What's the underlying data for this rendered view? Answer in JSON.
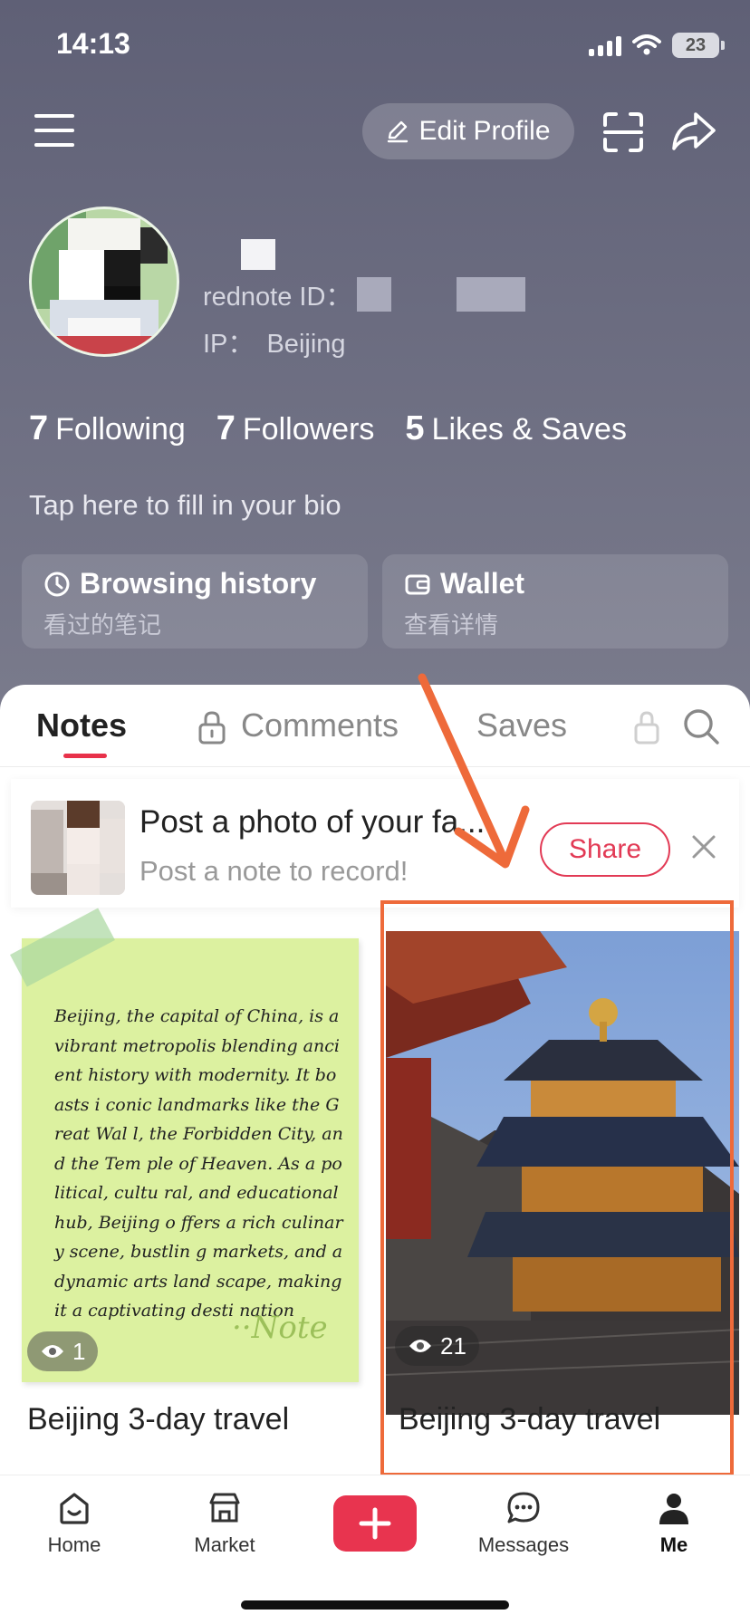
{
  "status_bar": {
    "time": "14:13",
    "battery": "23"
  },
  "header": {
    "edit_profile_label": "Edit Profile",
    "rednote_id_label": "rednote ID：",
    "ip_label": "IP：",
    "ip_value": "Beijing"
  },
  "stats": [
    {
      "count": "7",
      "label": "Following"
    },
    {
      "count": "7",
      "label": "Followers"
    },
    {
      "count": "5",
      "label": "Likes & Saves"
    }
  ],
  "bio_placeholder": "Tap here to fill in your bio",
  "cards": {
    "history": {
      "title": "Browsing history",
      "subtitle": "看过的笔记"
    },
    "wallet": {
      "title": "Wallet",
      "subtitle": "查看详情"
    }
  },
  "tabs": {
    "notes": "Notes",
    "comments": "Comments",
    "saves": "Saves"
  },
  "prompt": {
    "title": "Post a photo of your fa...",
    "subtitle": "Post a note to record!",
    "share_label": "Share"
  },
  "notes": [
    {
      "sticky_text": "Beijing, the capital of China, is a vibrant metropolis blending ancient history with modernity. It boasts i conic landmarks like the Great Wal l, the Forbidden City, and the Tem ple of Heaven. As a political, cultu ral, and educational hub, Beijing o ffers a rich culinary scene, bustlin g markets, and a dynamic arts land scape, making it a captivating desti nation",
      "sticky_signature": "··Note",
      "views": "1",
      "title": "Beijing 3-day travel"
    },
    {
      "views": "21",
      "title": "Beijing 3-day travel"
    }
  ],
  "nav": {
    "home": "Home",
    "market": "Market",
    "messages": "Messages",
    "me": "Me"
  },
  "colors": {
    "accent": "#e8344f",
    "highlight": "#ee6a3a"
  }
}
